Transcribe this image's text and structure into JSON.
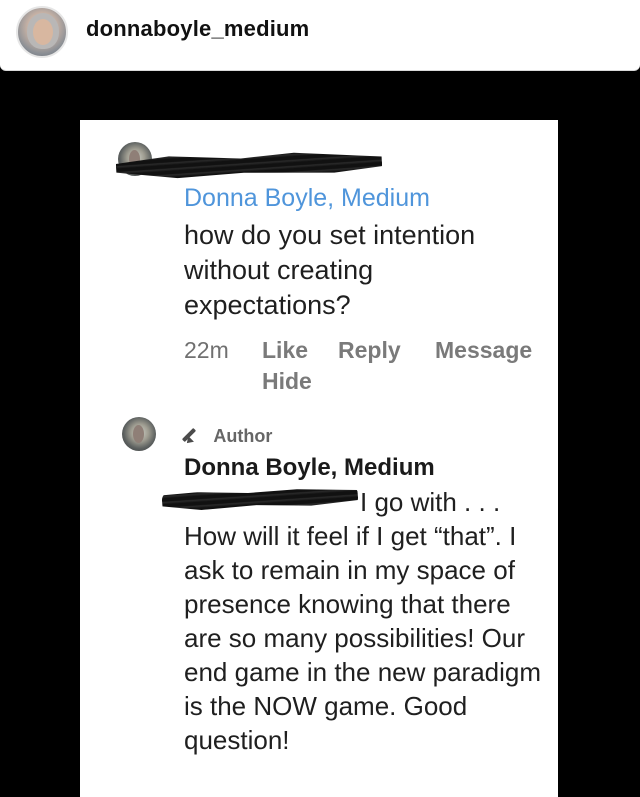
{
  "header": {
    "username": "donnaboyle_medium"
  },
  "screenshot": {
    "first_comment": {
      "author": "Donna Boyle, Medium",
      "text": "how do you set intention without creating expectations?",
      "time": "22m",
      "actions": {
        "like": "Like",
        "reply": "Reply",
        "message": "Message",
        "hide": "Hide"
      }
    },
    "reply": {
      "badge": "Author",
      "author": "Donna Boyle, Medium",
      "text_start": "I go with . . .",
      "text_rest": "How will it feel if I get “that”.  I ask to remain in my space of presence knowing that there are so many possibilities! Our end game in the new paradigm is the NOW game. Good question!"
    }
  },
  "icons": {
    "badge_icon": "pencil-icon"
  },
  "colors": {
    "page_background": "#000000",
    "header_background": "#ffffff",
    "author_link": "#4f95db",
    "text_primary": "#1f1f1f",
    "text_secondary": "#7a7a7a"
  }
}
